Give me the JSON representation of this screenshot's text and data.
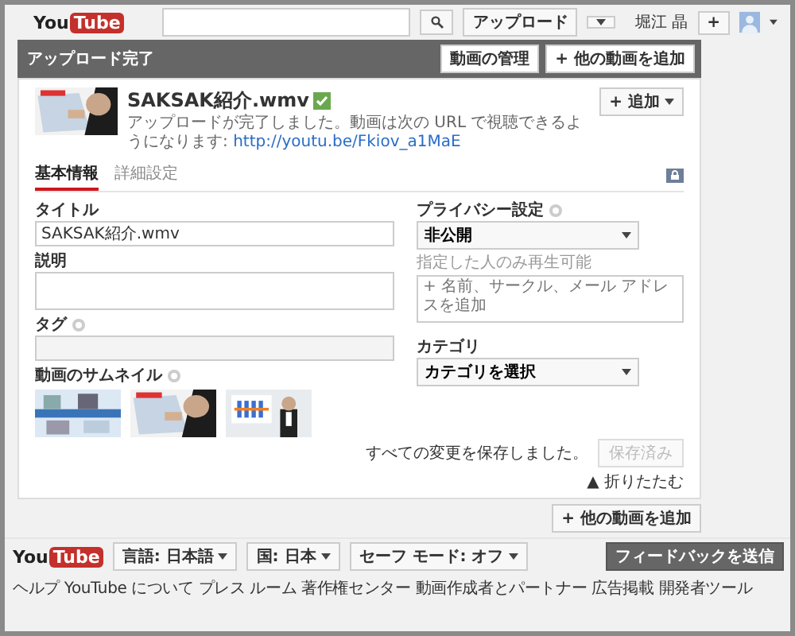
{
  "header": {
    "logo": {
      "you": "You",
      "tube": "Tube"
    },
    "upload_button": "アップロード",
    "user_name": "堀江 晶",
    "share_button": "+"
  },
  "upload_bar": {
    "title": "アップロード完了",
    "buttons": [
      "動画の管理",
      "+ 他の動画を追加"
    ]
  },
  "video": {
    "file_name": "SAKSAK紹介.wmv",
    "status_message": "アップロードが完了しました。動画は次の URL で視聴できるようになります:",
    "url": "http://youtu.be/Fkiov_a1MaE",
    "add_button": "+ 追加"
  },
  "tabs": [
    {
      "label": "基本情報",
      "selected": true
    },
    {
      "label": "詳細設定",
      "selected": false
    }
  ],
  "form": {
    "title_label": "タイトル",
    "title_value": "SAKSAK紹介.wmv",
    "description_label": "説明",
    "tags_label": "タグ",
    "thumbnails_label": "動画のサムネイル"
  },
  "privacy": {
    "label": "プライバシー設定",
    "value": "非公開",
    "note": "指定した人のみ再生可能",
    "share_placeholder": "+ 名前、サークル、メール アドレスを追加"
  },
  "category": {
    "label": "カテゴリ",
    "value": "カテゴリを選択"
  },
  "save": {
    "message": "すべての変更を保存しました。",
    "button": {
      "label": "保存済み",
      "disabled": true
    }
  },
  "collapse": "▲ 折りたたむ",
  "add_more_button": "+ 他の動画を追加",
  "footer": {
    "logo": {
      "you": "You",
      "tube": "Tube"
    },
    "selectors": [
      "言語: 日本語",
      "国: 日本",
      "セーフ モード: オフ"
    ],
    "links": [
      "ヘルプ",
      "YouTube について",
      "プレス ルーム",
      "著作権センター",
      "動画作成者とパートナー",
      "広告掲載",
      "開発者ツール"
    ],
    "feedback_button": "フィードバックを送信"
  }
}
